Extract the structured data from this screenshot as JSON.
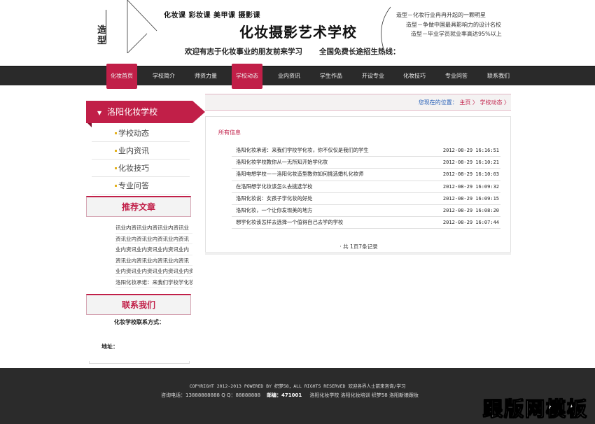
{
  "header": {
    "logo_text": "造型",
    "courses": "化妆课 彩妆课 美甲课 摄影课",
    "school_name": "化妆摄影艺术学校",
    "slogan_left": "欢迎有志于化妆事业的朋友前来学习",
    "slogan_right": "全国免费长途招生热线：",
    "taglines": [
      "造型－化妆行业冉冉升起的一颗明星",
      "造型－争做中国最具影响力的设计名校",
      "造型－毕业学员就业率高达95%以上"
    ]
  },
  "nav": {
    "items": [
      "化妆首页",
      "学校简介",
      "师资力量",
      "学校动态",
      "业内资讯",
      "学生作品",
      "开设专业",
      "化妆技巧",
      "专业问答",
      "联系我们"
    ],
    "active": [
      0,
      3
    ]
  },
  "breadcrumb": {
    "label": "您现在的位置：",
    "home": "主页",
    "sep": "〉",
    "current": "学校动态",
    "end": "〉"
  },
  "sidebar": {
    "title": "洛阳化妆学校",
    "items": [
      "学校动态",
      "业内资讯",
      "化妆技巧",
      "专业问答"
    ],
    "recommend_title": "推荐文章",
    "recommend_items": [
      "讯业内资讯业内资讯业内资讯业",
      "资讯业内资讯业内资讯业内资讯",
      "业内资讯业内资讯业内资讯业内",
      "资讯业内资讯业内资讯业内资讯",
      "业内资讯业内资讯业内资讯业内资",
      "洛阳化妆承诺：来我们学校学化妆"
    ],
    "contact_title": "联系我们",
    "contact_label": "化妆学校联系方式：",
    "address_label": "地址："
  },
  "main": {
    "title": "所有信息",
    "rows": [
      {
        "title": "洛阳化妆承诺：来我们学校学化妆，你不仅仅是我们的学生",
        "date": "2012-08-29 16:16:51"
      },
      {
        "title": "洛阳化妆学校教你从一无所知开始学化妆",
        "date": "2012-08-29 16:10:21"
      },
      {
        "title": "洛阳电想学校——洛阳化妆造型教你如何挑选婚礼化妆师",
        "date": "2012-08-29 16:10:03"
      },
      {
        "title": "在洛阳想学化妆该怎么去挑选学校",
        "date": "2012-08-29 16:09:32"
      },
      {
        "title": "洛阳化妆说：女孩子学化妆的好处",
        "date": "2012-08-29 16:09:15"
      },
      {
        "title": "洛阳化妆，一个让你发现美的地方",
        "date": "2012-08-29 16:08:20"
      },
      {
        "title": "想学化妆该怎样去选择一个值得自己去学的学校",
        "date": "2012-08-29 16:07:44"
      }
    ],
    "pager": "共 1页7条记录"
  },
  "footer": {
    "copyright": "COPYRIGHT 2012-2013 POWERED BY 织梦58，ALL RIGHTS RESERVED 欢迎各界人士前来咨询/学习",
    "phone": "咨询电话：13888888888 Q Q：88888888",
    "postcode": "邮编：471001",
    "links": "洛阳化妆学校 洛阳化妆培训 织梦58 洛阳新娘跟妆",
    "watermark": "跟版网模板"
  },
  "colors": {
    "accent": "#c11f48",
    "nav_bg": "#2a2a2a",
    "footer_bg": "#2b2b2b"
  }
}
